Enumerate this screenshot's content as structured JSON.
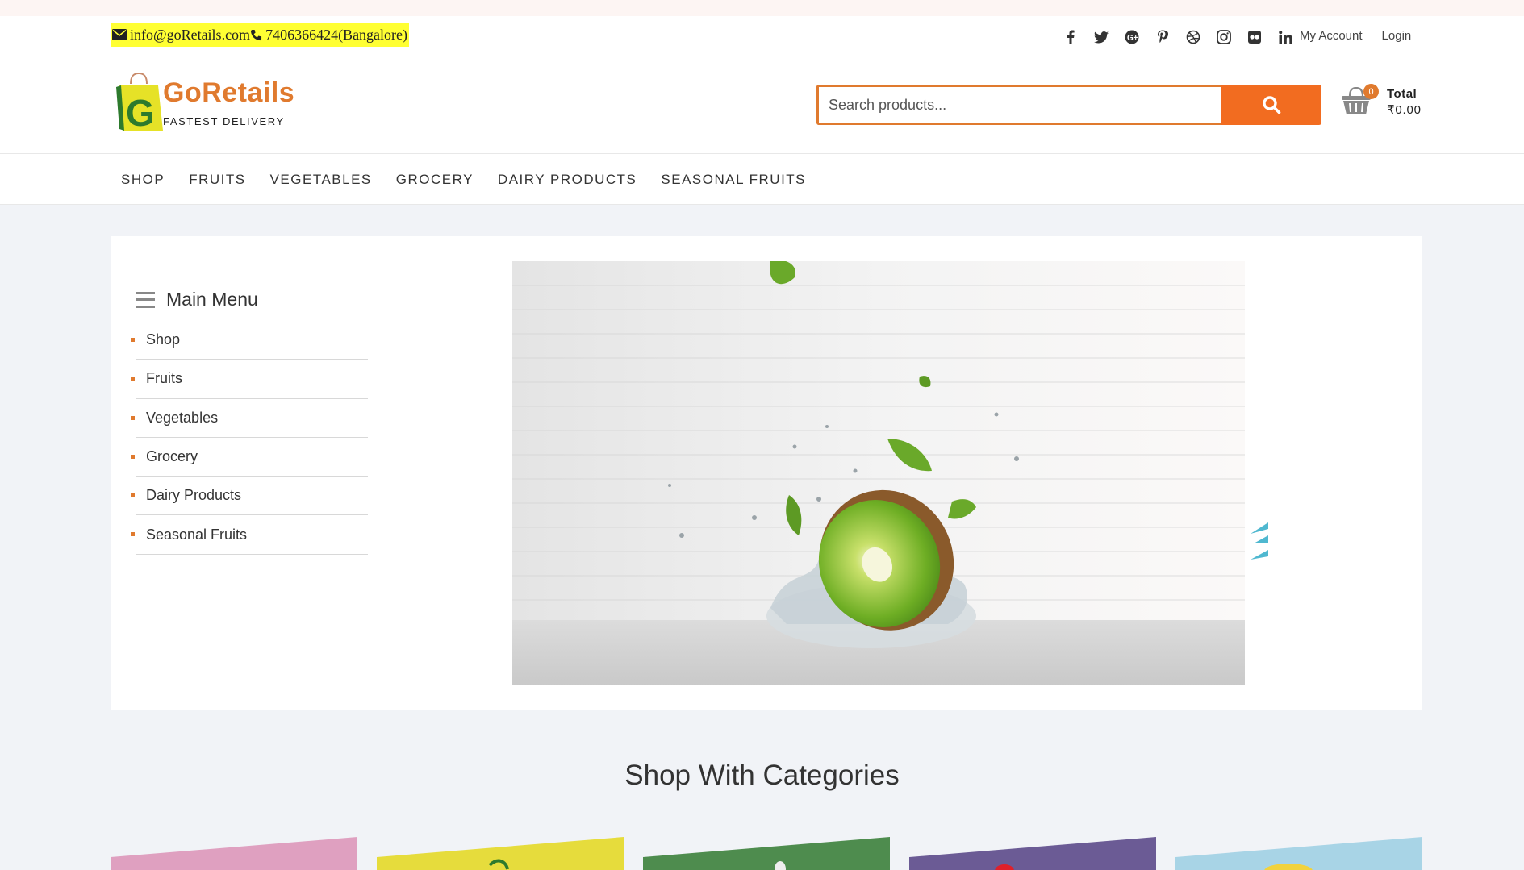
{
  "topbar": {
    "email": "info@goRetails.com",
    "phone": "7406366424(Bangalore)",
    "social": [
      "facebook-icon",
      "twitter-icon",
      "google-plus-icon",
      "pinterest-icon",
      "dribbble-icon",
      "instagram-icon",
      "flickr-icon",
      "linkedin-icon"
    ],
    "my_account": "My Account",
    "login": "Login"
  },
  "brand": {
    "name": "GoRetails",
    "tagline": "FASTEST DELIVERY",
    "logo_letter": "G",
    "color": "#e07a2e"
  },
  "search": {
    "placeholder": "Search products...",
    "button_icon": "search-icon",
    "button_color": "#f26c20"
  },
  "cart": {
    "count": "0",
    "total_label": "Total",
    "total_value": "₹0.00"
  },
  "nav": {
    "items": [
      "SHOP",
      "FRUITS",
      "VEGETABLES",
      "GROCERY",
      "DAIRY PRODUCTS",
      "SEASONAL FRUITS"
    ]
  },
  "sidebar": {
    "title": "Main Menu",
    "items": [
      "Shop",
      "Fruits",
      "Vegetables",
      "Grocery",
      "Dairy Products",
      "Seasonal Fruits"
    ]
  },
  "hero": {
    "image": "kiwi-splash-image"
  },
  "categories": {
    "title": "Shop With Categories",
    "tile_colors": [
      "#dfa0c0",
      "#e6dc3c",
      "#4e8c4e",
      "#6b5b95",
      "#a8d4e6"
    ]
  }
}
